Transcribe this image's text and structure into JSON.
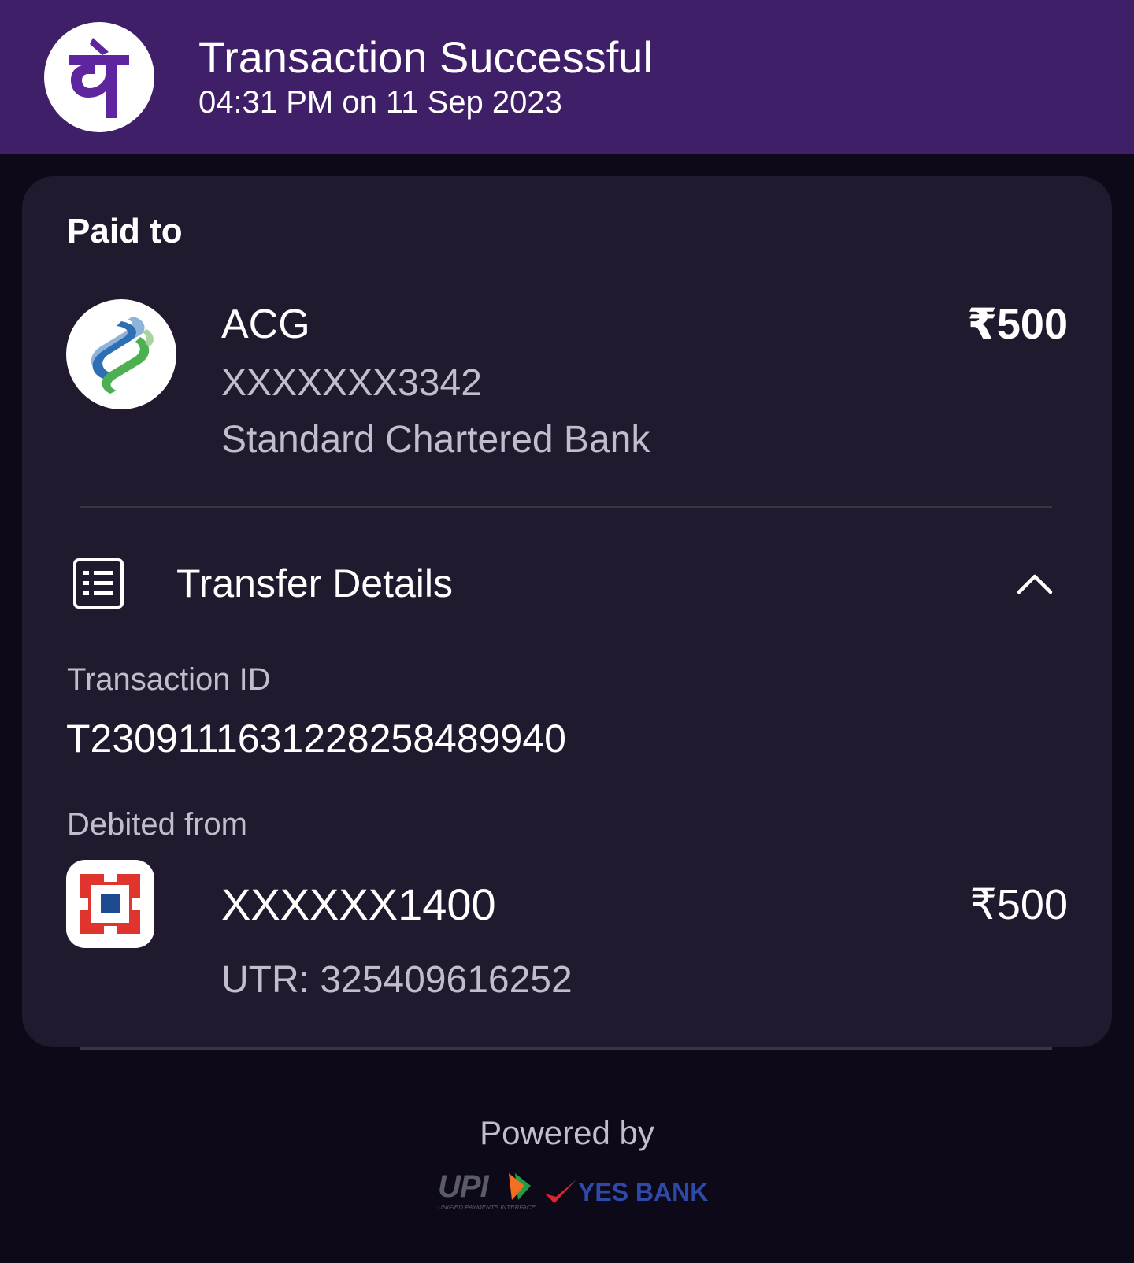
{
  "header": {
    "title": "Transaction Successful",
    "datetime": "04:31 PM on 11 Sep 2023",
    "logo_icon": "phonepe-logo-icon",
    "logo_glyph": "पे",
    "bg_color": "#3f1f68"
  },
  "paid_to": {
    "label": "Paid to",
    "name": "ACG",
    "amount": "₹500",
    "account": "XXXXXXX3342",
    "bank": "Standard Chartered Bank",
    "logo_icon": "standard-chartered-logo-icon"
  },
  "transfer_details": {
    "label": "Transfer Details",
    "icon": "receipt-list-icon",
    "toggle_icon": "chevron-up-icon",
    "transaction_id_label": "Transaction ID",
    "transaction_id": "T2309111631228258489940",
    "debited_from_label": "Debited from",
    "debit_account": "XXXXXX1400",
    "debit_amount": "₹500",
    "utr": "UTR: 325409616252",
    "debit_logo_icon": "hdfc-bank-logo-icon"
  },
  "footer": {
    "powered_by": "Powered by",
    "upi_logo_text": "UPI",
    "upi_tagline": "UNIFIED PAYMENTS INTERFACE",
    "bank_logo_text": "YES BANK"
  },
  "colors": {
    "background": "#0e0919",
    "card": "#211a2e",
    "accent": "#5f259f",
    "muted_text": "#c3bccf"
  }
}
